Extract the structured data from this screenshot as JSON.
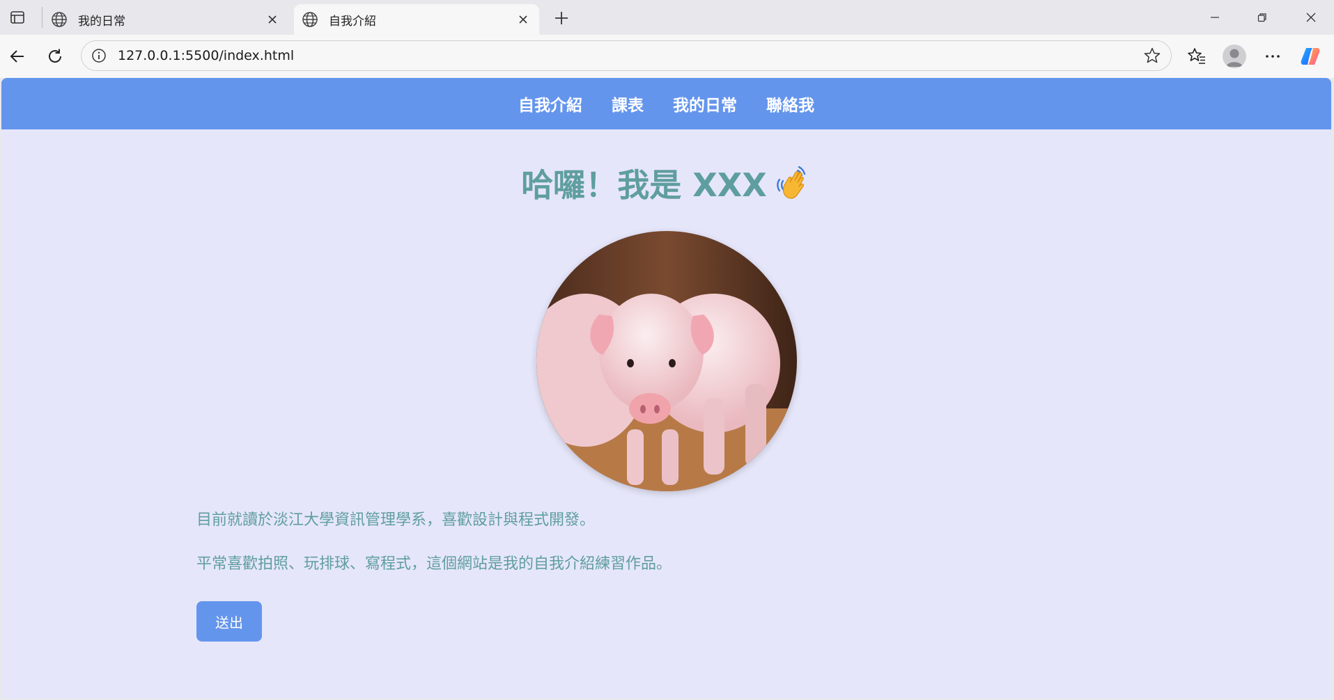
{
  "browser": {
    "tabs": [
      {
        "title": "我的日常",
        "active": false
      },
      {
        "title": "自我介紹",
        "active": true
      }
    ],
    "url": "127.0.0.1:5500/index.html"
  },
  "site": {
    "nav": [
      "自我介紹",
      "課表",
      "我的日常",
      "聯絡我"
    ],
    "heading": "哈囉！我是 XXX",
    "heading_emoji": "waving-hand-icon",
    "photo": "pig-photo",
    "paragraphs": [
      "目前就讀於淡江大學資訊管理學系，喜歡設計與程式開發。",
      "平常喜歡拍照、玩排球、寫程式，這個網站是我的自我介紹練習作品。"
    ],
    "submit_label": "送出"
  },
  "colors": {
    "nav_bg": "#6495ed",
    "page_bg": "#e6e6fa",
    "text": "#5f9ea0",
    "button_bg": "#6495ed"
  }
}
